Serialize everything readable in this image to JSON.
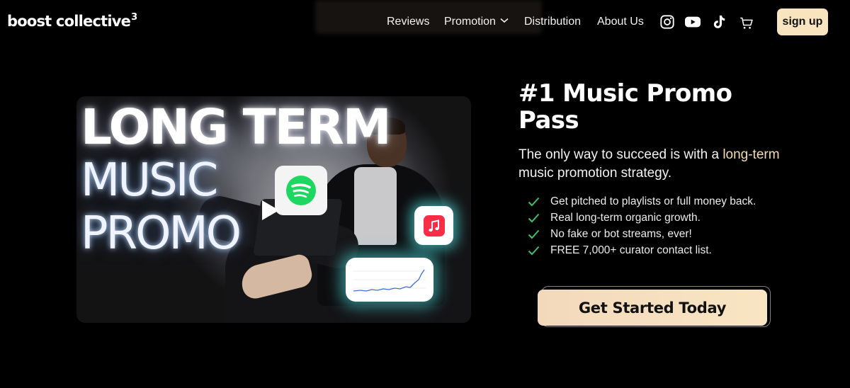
{
  "header": {
    "logo_text": "boost collective",
    "logo_mark": "3",
    "nav": [
      {
        "label": "Reviews"
      },
      {
        "label": "Promotion",
        "has_dropdown": true
      },
      {
        "label": "Distribution"
      },
      {
        "label": "About Us"
      }
    ],
    "icons": [
      "instagram-icon",
      "youtube-icon",
      "tiktok-icon",
      "cart-icon"
    ],
    "signup_label": "sign up"
  },
  "video": {
    "title_line1": "LONG TERM",
    "title_line2": "MUSIC",
    "title_line3": "PROMO",
    "icons": [
      "spotify-icon",
      "apple-music-icon",
      "play-icon"
    ]
  },
  "hero": {
    "title": "#1 Music Promo Pass",
    "subtitle_before": "The only way to succeed is with a ",
    "subtitle_highlight": "long-term",
    "subtitle_after": " music promotion strategy.",
    "features": [
      "Get pitched to playlists or full money back.",
      "Real long-term organic growth.",
      "No fake or bot streams, ever!",
      "FREE 7,000+ curator contact list."
    ],
    "cta_label": "Get Started Today"
  },
  "colors": {
    "background": "#000000",
    "accent_cream": "#f8e4bf",
    "highlight": "#f5dcae",
    "check_green": "#3fc06a",
    "spotify_green": "#1ed760",
    "apple_music_red": "#fa2d48"
  }
}
